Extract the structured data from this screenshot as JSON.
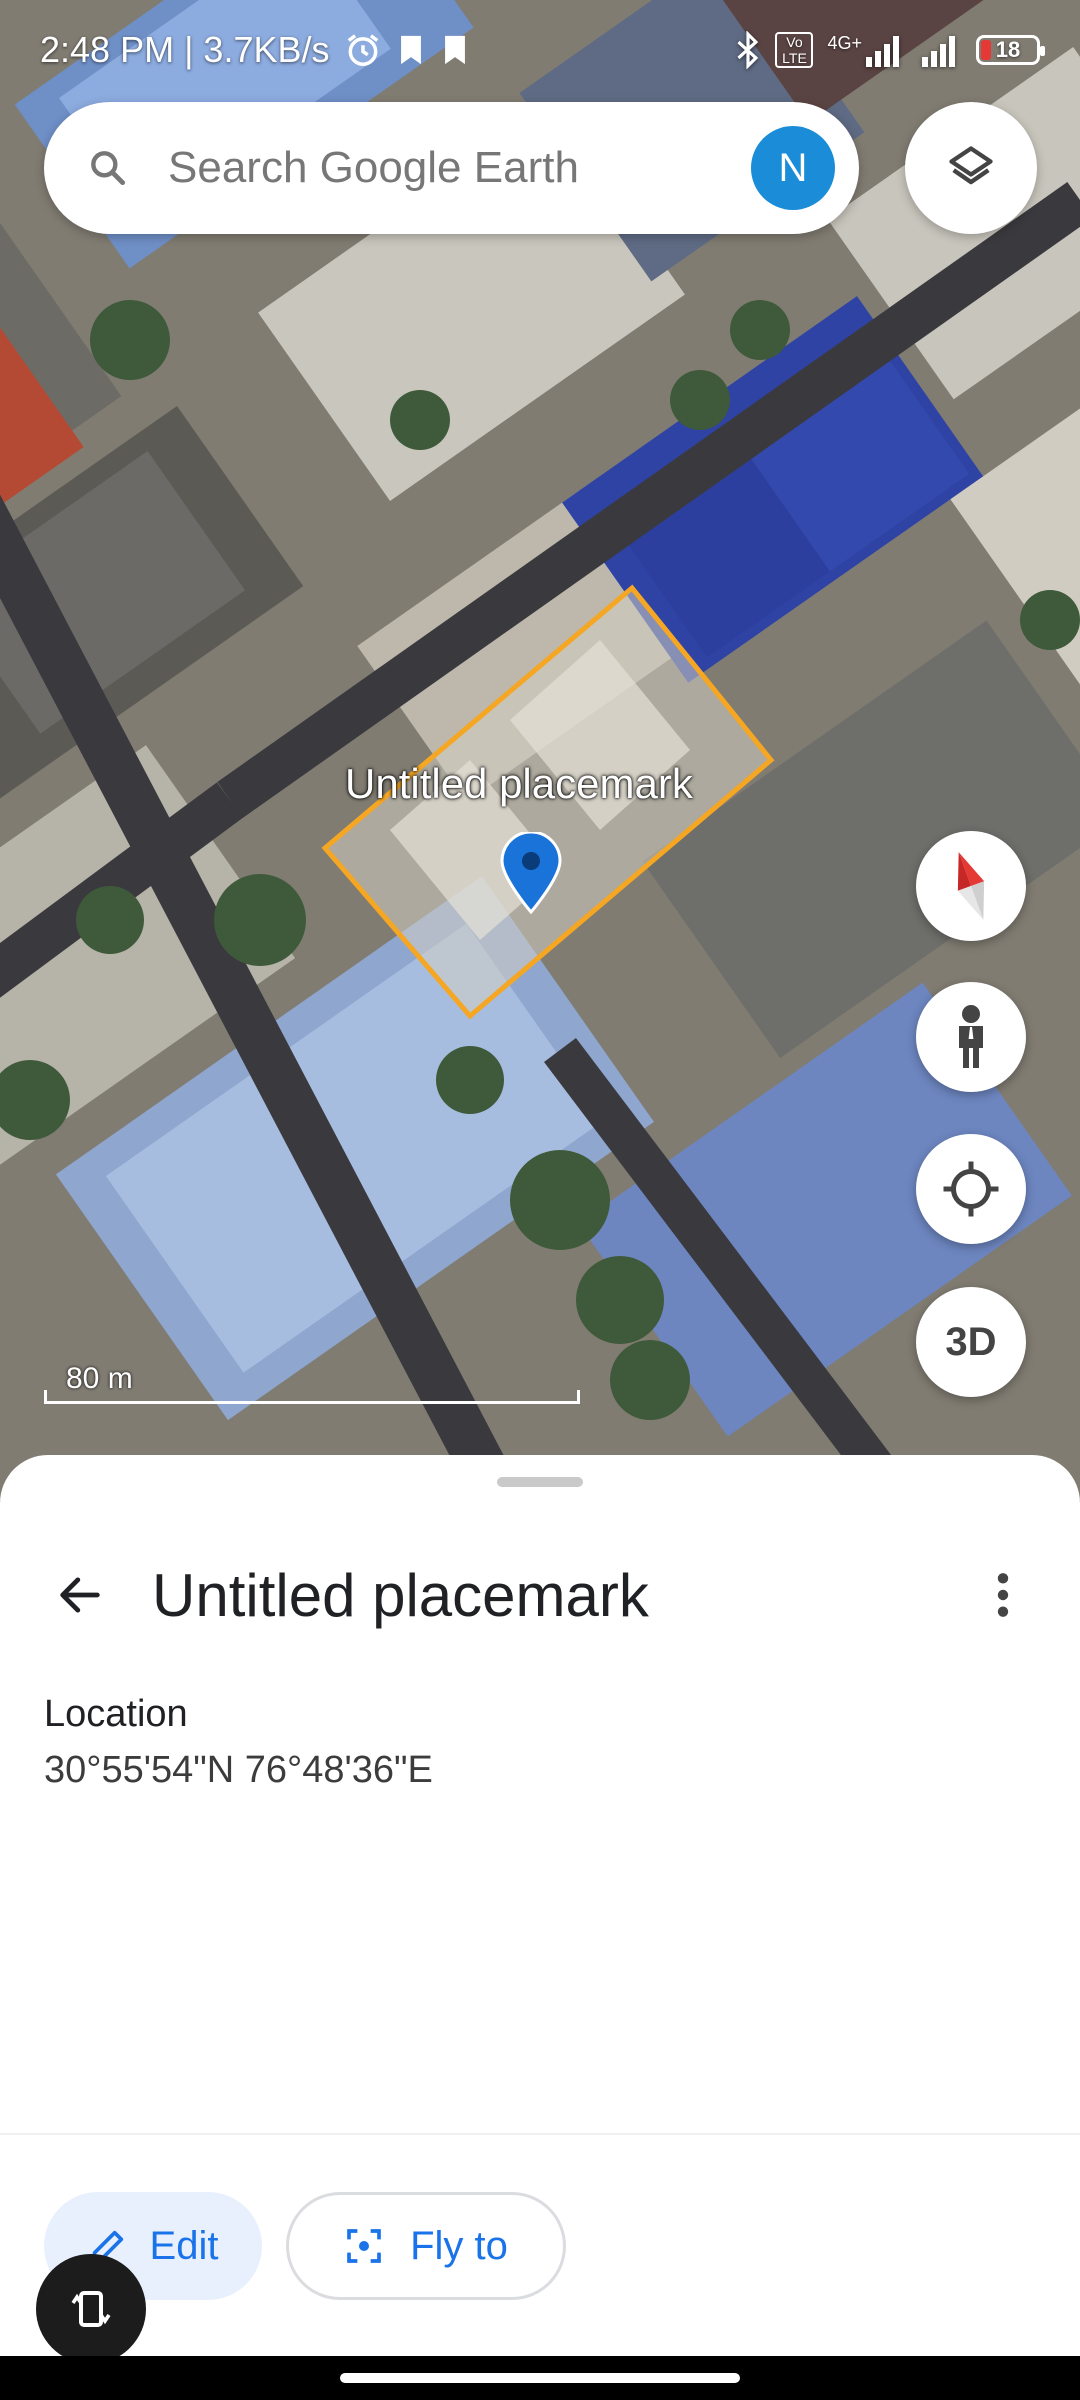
{
  "status_bar": {
    "time_speed": "2:48 PM | 3.7KB/s",
    "network": "4G+",
    "volte": "Vo LTE",
    "battery": "18"
  },
  "search": {
    "placeholder": "Search Google Earth",
    "avatar_initial": "N"
  },
  "map": {
    "placemark_label": "Untitled placemark",
    "scale": "80 m"
  },
  "fabs": {
    "three_d": "3D"
  },
  "sheet": {
    "title": "Untitled placemark",
    "location_label": "Location",
    "location_value": "30°55'54\"N 76°48'36\"E",
    "edit_label": "Edit",
    "flyto_label": "Fly to"
  },
  "colors": {
    "accent": "#1a73e8",
    "avatar": "#1a8cd8",
    "polygon": "#f5a623",
    "pin": "#1a73d8"
  },
  "icons": [
    "search-icon",
    "layers-icon",
    "compass-icon",
    "pegman-icon",
    "my-location-icon",
    "back-arrow-icon",
    "more-vert-icon",
    "edit-pencil-icon",
    "fly-to-icon",
    "rotate-screen-icon",
    "bluetooth-icon",
    "alarm-icon"
  ]
}
